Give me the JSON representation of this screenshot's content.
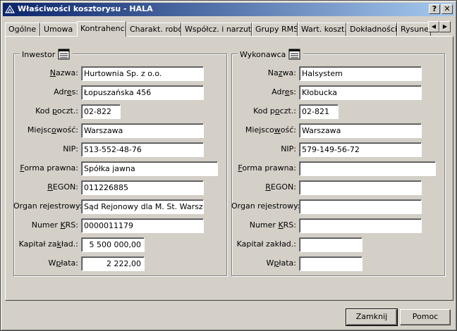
{
  "window": {
    "title": "Właściwości kosztorysu - HALA",
    "help_glyph": "?",
    "close_glyph": "✕"
  },
  "tabs": [
    {
      "label": "Ogólne"
    },
    {
      "label": "Umowa"
    },
    {
      "label": "Kontrahenci"
    },
    {
      "label": "Charakt. robót"
    },
    {
      "label": "Współcz. i narzuty"
    },
    {
      "label": "Grupy RMS"
    },
    {
      "label": "Wart. koszt."
    },
    {
      "label": "Dokładności"
    },
    {
      "label": "Rysune"
    }
  ],
  "tab_scroll": {
    "left_glyph": "◀",
    "right_glyph": "▶"
  },
  "investor": {
    "title": "Inwestor",
    "labels": {
      "nazwa": [
        "",
        "N",
        "azwa:"
      ],
      "adres": [
        "Adr",
        "e",
        "s:"
      ],
      "kod": [
        "Kod ",
        "p",
        "oczt.:"
      ],
      "miejscowosc": [
        "Miejsc",
        "o",
        "wość:"
      ],
      "nip": [
        "NIP:"
      ],
      "forma": [
        "",
        "F",
        "orma prawna:"
      ],
      "regon": [
        "",
        "R",
        "EGON:"
      ],
      "organ": [
        "Organ rejestrowy:"
      ],
      "krs": [
        "Numer ",
        "K",
        "RS:"
      ],
      "kapital": [
        "Kapitał za",
        "k",
        "ład.:"
      ],
      "wplata": [
        "W",
        "p",
        "łata:"
      ]
    },
    "values": {
      "nazwa": "Hurtownia Sp. z o.o.",
      "adres": "Łopuszańska 456",
      "kod": "02-822",
      "miejscowosc": "Warszawa",
      "nip": "513-552-48-76",
      "forma": "Spółka jawna",
      "regon": "011226885",
      "organ": "Sąd Rejonowy dla M. St. Warszawa",
      "krs": "0000011179",
      "kapital": "5 500 000,00",
      "wplata": "2 222,00"
    }
  },
  "contractor": {
    "title": "Wykonawca",
    "labels": {
      "nazwa": [
        "Na",
        "z",
        "wa:"
      ],
      "adres": [
        "Adr",
        "e",
        "s:"
      ],
      "kod": [
        "Kod p",
        "o",
        "czt.:"
      ],
      "miejscowosc": [
        "Miejsco",
        "w",
        "ość:"
      ],
      "nip": [
        "NIP:"
      ],
      "forma": [
        "",
        "F",
        "orma prawna:"
      ],
      "regon": [
        "",
        "R",
        "EGON:"
      ],
      "organ": [
        "Organ rejestrowy:"
      ],
      "krs": [
        "Numer ",
        "K",
        "RS:"
      ],
      "kapital": [
        "Kapitał zakład.:"
      ],
      "wplata": [
        "W",
        "p",
        "łata:"
      ]
    },
    "values": {
      "nazwa": "Halsystem",
      "adres": "Kłobucka",
      "kod": "02-821",
      "miejscowosc": "Warszawa",
      "nip": "579-149-56-72",
      "forma": "",
      "regon": "",
      "organ": "",
      "krs": "",
      "kapital": "",
      "wplata": ""
    }
  },
  "buttons": {
    "close": "Zamknij",
    "help": "Pomoc"
  }
}
